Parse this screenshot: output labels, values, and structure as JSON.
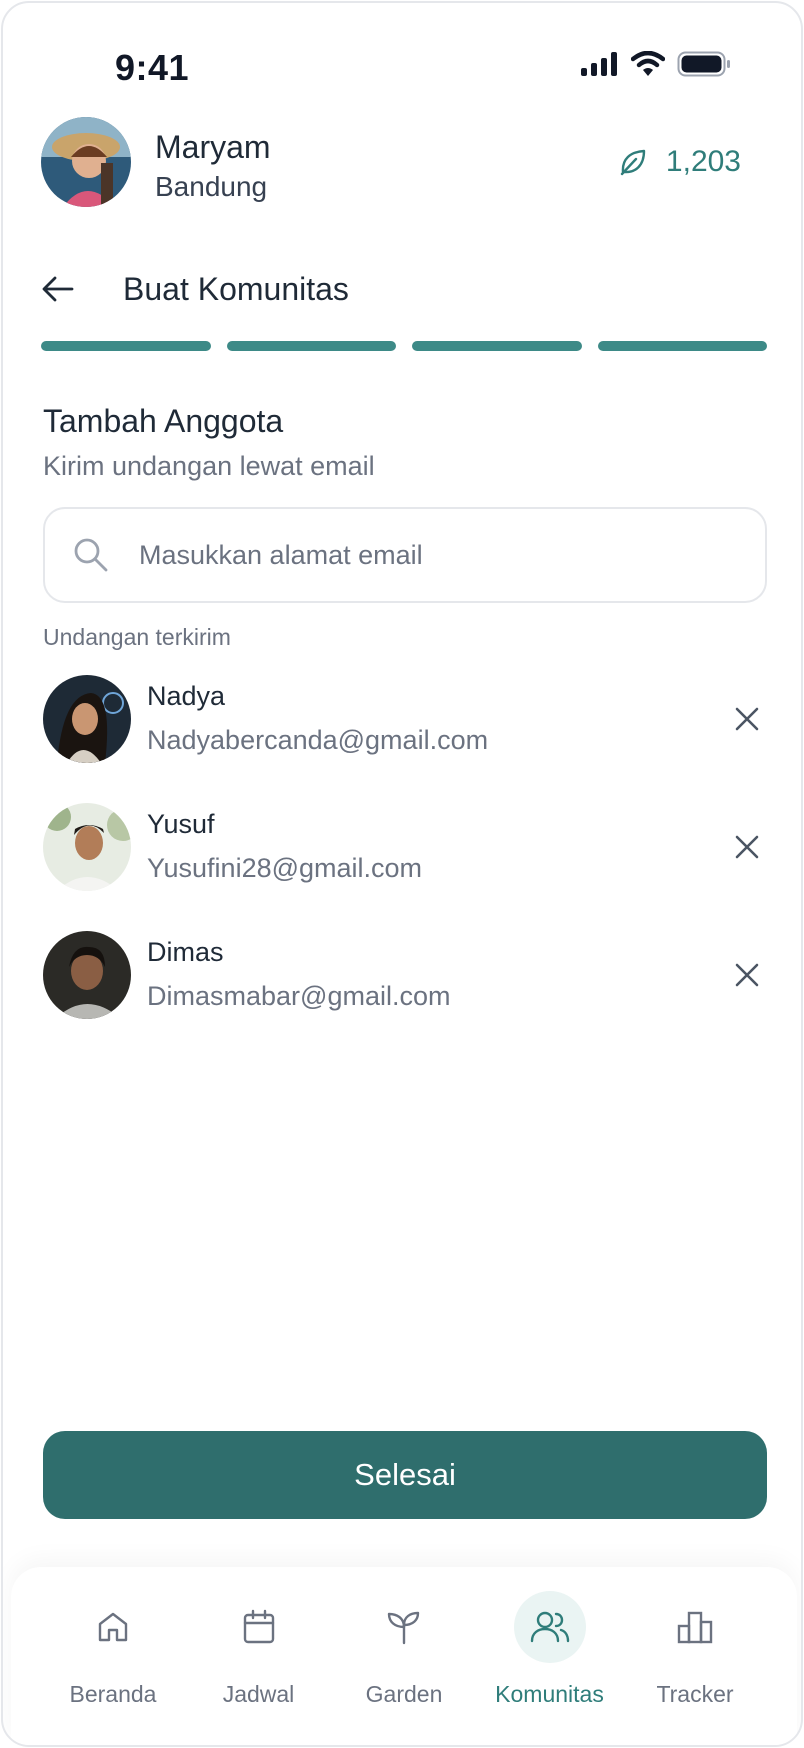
{
  "status_bar": {
    "time": "9:41"
  },
  "profile": {
    "name": "Maryam",
    "city": "Bandung",
    "points": "1,203",
    "points_icon": "leaf-icon"
  },
  "header": {
    "title": "Buat Komunitas",
    "back_icon": "arrow-left-icon"
  },
  "progress": {
    "total_steps": 4,
    "completed_steps": 4,
    "color": "#3d8a87"
  },
  "section": {
    "title": "Tambah Anggota",
    "subtitle": "Kirim undangan lewat email"
  },
  "search": {
    "placeholder": "Masukkan alamat email",
    "value": ""
  },
  "invited": {
    "label": "Undangan terkirim",
    "items": [
      {
        "name": "Nadya",
        "email": "Nadyabercanda@gmail.com"
      },
      {
        "name": "Yusuf",
        "email": "Yusufini28@gmail.com"
      },
      {
        "name": "Dimas",
        "email": "Dimasmabar@gmail.com"
      }
    ]
  },
  "done_button": {
    "label": "Selesai",
    "color": "#2f6e6d"
  },
  "nav": {
    "items": [
      {
        "label": "Beranda",
        "icon": "home-icon",
        "active": false
      },
      {
        "label": "Jadwal",
        "icon": "calendar-icon",
        "active": false
      },
      {
        "label": "Garden",
        "icon": "sprout-icon",
        "active": false
      },
      {
        "label": "Komunitas",
        "icon": "users-icon",
        "active": true
      },
      {
        "label": "Tracker",
        "icon": "bar-chart-icon",
        "active": false
      }
    ],
    "active_color": "#2f7d7a"
  }
}
